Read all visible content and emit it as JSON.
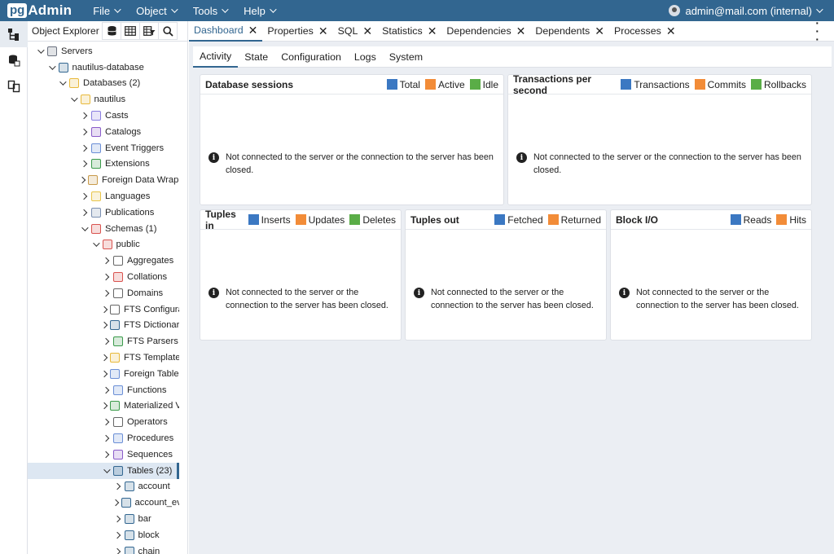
{
  "app": {
    "logo_pg": "pg",
    "logo_admin": "Admin",
    "menus": [
      "File",
      "Object",
      "Tools",
      "Help"
    ],
    "user": "admin@mail.com (internal)"
  },
  "explorer": {
    "title": "Object Explorer",
    "tree": [
      {
        "label": "Servers",
        "level": 0,
        "arrow": "down",
        "icon": "servers-icon",
        "color": "#6b7280"
      },
      {
        "label": "nautilus-database",
        "level": 1,
        "arrow": "down",
        "icon": "postgres-elephant-icon",
        "color": "#336791"
      },
      {
        "label": "Databases (2)",
        "level": 2,
        "arrow": "down",
        "icon": "databases-icon",
        "color": "#e8b93b"
      },
      {
        "label": "nautilus",
        "level": 3,
        "arrow": "down",
        "icon": "database-icon",
        "color": "#e8b93b"
      },
      {
        "label": "Casts",
        "level": 4,
        "arrow": "right",
        "icon": "casts-icon",
        "color": "#8a7ee0"
      },
      {
        "label": "Catalogs",
        "level": 4,
        "arrow": "right",
        "icon": "catalogs-icon",
        "color": "#8a5cc9"
      },
      {
        "label": "Event Triggers",
        "level": 4,
        "arrow": "right",
        "icon": "event-triggers-icon",
        "color": "#6b8fd6"
      },
      {
        "label": "Extensions",
        "level": 4,
        "arrow": "right",
        "icon": "extensions-icon",
        "color": "#3a9a4a"
      },
      {
        "label": "Foreign Data Wrappers",
        "level": 4,
        "arrow": "right",
        "icon": "foreign-data-wrapper-icon",
        "color": "#c89a4a"
      },
      {
        "label": "Languages",
        "level": 4,
        "arrow": "right",
        "icon": "languages-icon",
        "color": "#e8c54a"
      },
      {
        "label": "Publications",
        "level": 4,
        "arrow": "right",
        "icon": "publications-icon",
        "color": "#7a8fb0"
      },
      {
        "label": "Schemas (1)",
        "level": 4,
        "arrow": "down",
        "icon": "schemas-icon",
        "color": "#d9534f"
      },
      {
        "label": "public",
        "level": 5,
        "arrow": "down",
        "icon": "schema-icon",
        "color": "#d9534f"
      },
      {
        "label": "Aggregates",
        "level": 6,
        "arrow": "right",
        "icon": "aggregates-icon",
        "color": "#666"
      },
      {
        "label": "Collations",
        "level": 6,
        "arrow": "right",
        "icon": "collations-icon",
        "color": "#d9534f"
      },
      {
        "label": "Domains",
        "level": 6,
        "arrow": "right",
        "icon": "domains-icon",
        "color": "#666"
      },
      {
        "label": "FTS Configurations",
        "level": 6,
        "arrow": "right",
        "icon": "fts-configurations-icon",
        "color": "#666"
      },
      {
        "label": "FTS Dictionaries",
        "level": 6,
        "arrow": "right",
        "icon": "fts-dictionaries-icon",
        "color": "#336791"
      },
      {
        "label": "FTS Parsers",
        "level": 6,
        "arrow": "right",
        "icon": "fts-parsers-icon",
        "color": "#3a9a4a"
      },
      {
        "label": "FTS Templates",
        "level": 6,
        "arrow": "right",
        "icon": "fts-templates-icon",
        "color": "#e8b93b"
      },
      {
        "label": "Foreign Tables",
        "level": 6,
        "arrow": "right",
        "icon": "foreign-tables-icon",
        "color": "#6b8fd6"
      },
      {
        "label": "Functions",
        "level": 6,
        "arrow": "right",
        "icon": "functions-icon",
        "color": "#6b8fd6"
      },
      {
        "label": "Materialized Views",
        "level": 6,
        "arrow": "right",
        "icon": "materialized-views-icon",
        "color": "#3a9a4a"
      },
      {
        "label": "Operators",
        "level": 6,
        "arrow": "right",
        "icon": "operators-icon",
        "color": "#666"
      },
      {
        "label": "Procedures",
        "level": 6,
        "arrow": "right",
        "icon": "procedures-icon",
        "color": "#6b8fd6"
      },
      {
        "label": "Sequences",
        "level": 6,
        "arrow": "right",
        "icon": "sequences-icon",
        "color": "#8a5cc9"
      },
      {
        "label": "Tables (23)",
        "level": 6,
        "arrow": "down",
        "icon": "tables-icon",
        "color": "#336791",
        "selected": true
      },
      {
        "label": "account",
        "level": 7,
        "arrow": "right",
        "icon": "table-icon",
        "color": "#336791"
      },
      {
        "label": "account_events",
        "level": 7,
        "arrow": "right",
        "icon": "table-icon",
        "color": "#336791"
      },
      {
        "label": "bar",
        "level": 7,
        "arrow": "right",
        "icon": "table-icon",
        "color": "#336791"
      },
      {
        "label": "block",
        "level": 7,
        "arrow": "right",
        "icon": "table-icon",
        "color": "#336791"
      },
      {
        "label": "chain",
        "level": 7,
        "arrow": "right",
        "icon": "table-icon",
        "color": "#336791"
      }
    ]
  },
  "tabs": [
    {
      "label": "Dashboard",
      "active": true
    },
    {
      "label": "Properties"
    },
    {
      "label": "SQL"
    },
    {
      "label": "Statistics"
    },
    {
      "label": "Dependencies"
    },
    {
      "label": "Dependents"
    },
    {
      "label": "Processes"
    }
  ],
  "subtabs": [
    "Activity",
    "State",
    "Configuration",
    "Logs",
    "System"
  ],
  "colors": {
    "blue": "#3b78c2",
    "orange": "#f28c38",
    "green": "#5aad47",
    "brand": "#326690"
  },
  "cards": [
    {
      "title": "Database sessions",
      "legend": [
        "Total",
        "Active",
        "Idle"
      ],
      "legend_colors": [
        "#3b78c2",
        "#f28c38",
        "#5aad47"
      ],
      "message": "Not connected to the server or the connection to the server has been closed."
    },
    {
      "title": "Transactions per second",
      "legend": [
        "Transactions",
        "Commits",
        "Rollbacks"
      ],
      "legend_colors": [
        "#3b78c2",
        "#f28c38",
        "#5aad47"
      ],
      "message": "Not connected to the server or the connection to the server has been closed."
    },
    {
      "title": "Tuples in",
      "legend": [
        "Inserts",
        "Updates",
        "Deletes"
      ],
      "legend_colors": [
        "#3b78c2",
        "#f28c38",
        "#5aad47"
      ],
      "message": "Not connected to the server or the connection to the server has been closed."
    },
    {
      "title": "Tuples out",
      "legend": [
        "Fetched",
        "Returned"
      ],
      "legend_colors": [
        "#3b78c2",
        "#f28c38"
      ],
      "message": "Not connected to the server or the connection to the server has been closed."
    },
    {
      "title": "Block I/O",
      "legend": [
        "Reads",
        "Hits"
      ],
      "legend_colors": [
        "#3b78c2",
        "#f28c38"
      ],
      "message": "Not connected to the server or the connection to the server has been closed."
    }
  ]
}
